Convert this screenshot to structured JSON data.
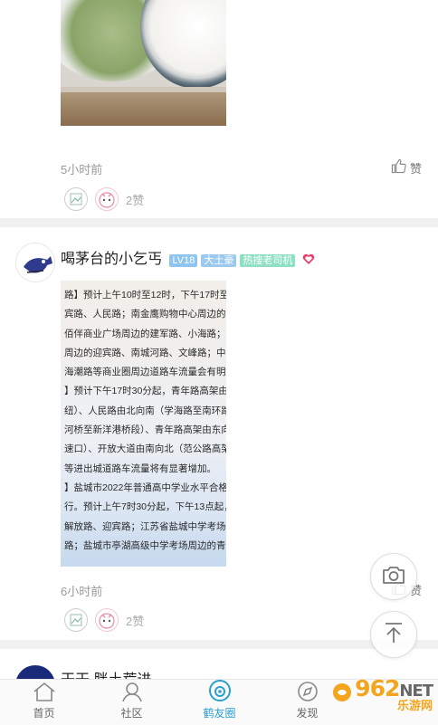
{
  "feed": {
    "post1": {
      "time": "5小时前",
      "like_label": "赞",
      "likes_count": "2赞"
    },
    "post2": {
      "username": "喝茅台的小乞丐",
      "badges": [
        "LV18",
        "大土豪",
        "热搜老司机"
      ],
      "image_lines": [
        "路】预计上午10时至12时，下午17时至",
        "宾路、人民路；南金鹰购物中心周边的解",
        "佰伴商业广场周边的建军路、小海路；五",
        "周边的迎宾路、南城河路、文峰路；中南",
        "海潮路等商业圈周边道路车流量会有明显",
        "】预计下午17时30分起，青年路高架由西",
        "纽）、人民路由北向南（学海路至南环路",
        "河桥至新洋港桥段）、青年路高架由东向",
        "速口）、开放大道由南向北（范公路高架",
        "等进出城道路车流量将有显著增加。",
        "】盐城市2022年普通高中学业水平合格性",
        "行。预计上午7时30分起，下午13点起，E",
        "解放路、迎宾路；江苏省盐城中学考场周",
        "路；盐城市亭湖高级中学考场周边的青年"
      ],
      "time": "6小时前",
      "like_label": "赞",
      "likes_count": "2赞"
    },
    "post3": {
      "username": "干干.胖土荒进"
    }
  },
  "bottom_nav": {
    "items": [
      {
        "label": "首页",
        "icon": "home-icon"
      },
      {
        "label": "社区",
        "icon": "community-icon"
      },
      {
        "label": "鹤友圈",
        "icon": "circle-icon"
      },
      {
        "label": "发现",
        "icon": "discover-icon"
      }
    ],
    "active": "鹤友圈"
  },
  "watermark": {
    "number": "962",
    "suffix": "NET",
    "sub": "乐游网"
  },
  "colors": {
    "accent": "#2a9fd0",
    "heart": "#e8406a",
    "watermark": "#f2a51d"
  }
}
